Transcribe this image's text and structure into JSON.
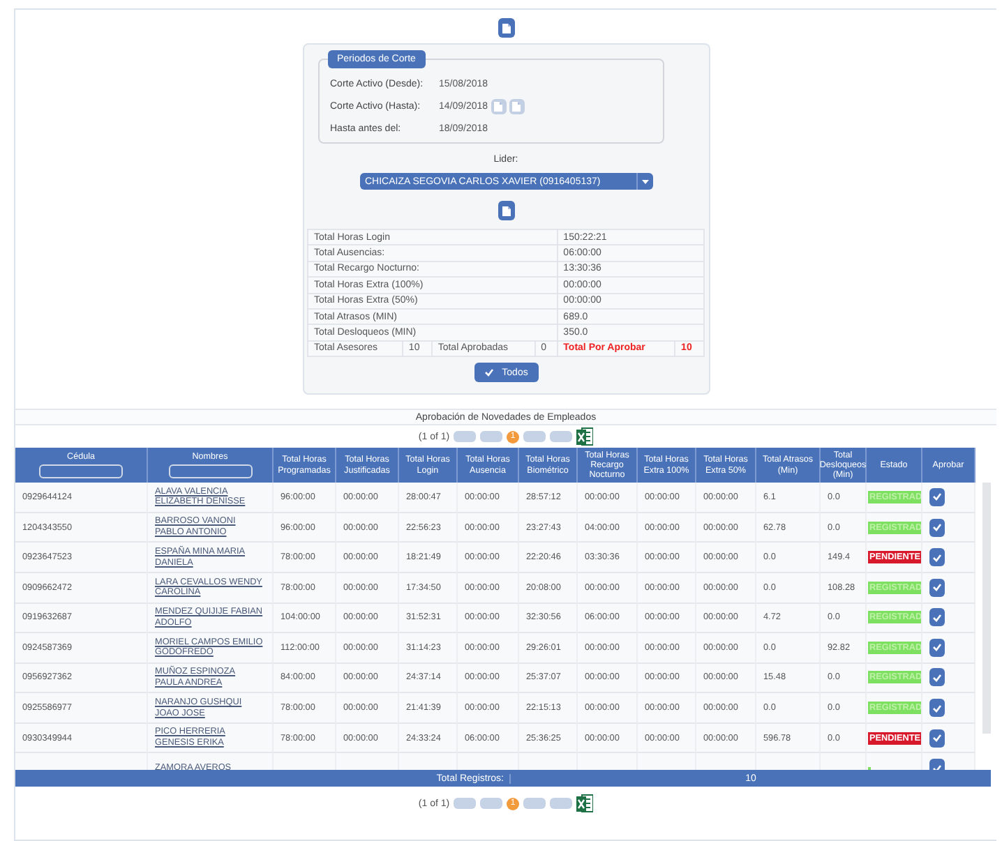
{
  "period_box": {
    "legend": "Periodos de Corte",
    "fields": [
      {
        "label": "Corte Activo (Desde):",
        "value": "15/08/2018",
        "nav": false
      },
      {
        "label": "Corte Activo (Hasta):",
        "value": "14/09/2018",
        "nav": true
      },
      {
        "label": "Hasta antes del:",
        "value": "18/09/2018",
        "nav": false
      }
    ]
  },
  "leader": {
    "label": "Lider:",
    "value": "CHICAIZA SEGOVIA CARLOS XAVIER (0916405137)"
  },
  "summary": [
    {
      "label": "Total Horas Login",
      "value": "150:22:21"
    },
    {
      "label": "Total Ausencias:",
      "value": "06:00:00"
    },
    {
      "label": "Total Recargo Nocturno:",
      "value": "13:30:36"
    },
    {
      "label": "Total Horas Extra (100%)",
      "value": "00:00:00"
    },
    {
      "label": "Total Horas Extra (50%)",
      "value": "00:00:00"
    },
    {
      "label": "Total Atrasos (MIN)",
      "value": "689.0"
    },
    {
      "label": "Total Desloqueos (MIN)",
      "value": "350.0"
    }
  ],
  "counts": [
    {
      "label": "Total Asesores",
      "value": "10",
      "alert": false
    },
    {
      "label": "Total Aprobadas",
      "value": "0",
      "alert": false
    },
    {
      "label": "Total Por Aprobar",
      "value": "10",
      "alert": true
    }
  ],
  "approve_all": "Todos",
  "table": {
    "title": "Aprobación de Novedades de Empleados",
    "paginator": {
      "text": "(1 of 1)",
      "pages": [
        {
          "label": "1",
          "selected": true
        }
      ]
    },
    "columns": [
      {
        "label": "Cédula",
        "filter": true
      },
      {
        "label": "Nombres",
        "filter": true
      },
      {
        "label": "Total Horas Programadas",
        "filter": false
      },
      {
        "label": "Total Horas Justificadas",
        "filter": false
      },
      {
        "label": "Total Horas Login",
        "filter": false
      },
      {
        "label": "Total Horas Ausencia",
        "filter": false
      },
      {
        "label": "Total Horas Biométrico",
        "filter": false
      },
      {
        "label": "Total Horas Recargo Nocturno",
        "filter": false
      },
      {
        "label": "Total Horas Extra 100%",
        "filter": false
      },
      {
        "label": "Total Horas Extra 50%",
        "filter": false
      },
      {
        "label": "Total Atrasos (Min)",
        "filter": false
      },
      {
        "label": "Total Desloqueos (Min)",
        "filter": false
      },
      {
        "label": "Estado",
        "filter": false
      },
      {
        "label": "Aprobar",
        "filter": false
      }
    ],
    "rows": [
      {
        "cedula": "0929644124",
        "name": "ALAVA VALENCIA ELIZABETH DENISSE",
        "values": [
          "96:00:00",
          "00:00:00",
          "28:00:47",
          "00:00:00",
          "28:57:12",
          "00:00:00",
          "00:00:00",
          "00:00:00",
          "6.1",
          "0.0"
        ],
        "status": {
          "text": "REGISTRAD",
          "kind": "registered"
        }
      },
      {
        "cedula": "1204343550",
        "name": "BARROSO VANONI PABLO ANTONIO",
        "values": [
          "96:00:00",
          "00:00:00",
          "22:56:23",
          "00:00:00",
          "23:27:43",
          "04:00:00",
          "00:00:00",
          "00:00:00",
          "62.78",
          "0.0"
        ],
        "status": {
          "text": "REGISTRAD",
          "kind": "registered"
        }
      },
      {
        "cedula": "0923647523",
        "name": "ESPAÑA MINA MARIA DANIELA",
        "values": [
          "78:00:00",
          "00:00:00",
          "18:21:49",
          "00:00:00",
          "22:20:46",
          "03:30:36",
          "00:00:00",
          "00:00:00",
          "0.0",
          "149.4"
        ],
        "status": {
          "text": "PENDIENTE",
          "kind": "pending"
        }
      },
      {
        "cedula": "0909662472",
        "name": "LARA CEVALLOS WENDY CAROLINA",
        "values": [
          "78:00:00",
          "00:00:00",
          "17:34:50",
          "00:00:00",
          "20:08:00",
          "00:00:00",
          "00:00:00",
          "00:00:00",
          "0.0",
          "108.28"
        ],
        "status": {
          "text": "REGISTRAD",
          "kind": "registered"
        }
      },
      {
        "cedula": "0919632687",
        "name": "MENDEZ QUIJIJE FABIAN ADOLFO",
        "values": [
          "104:00:00",
          "00:00:00",
          "31:52:31",
          "00:00:00",
          "32:30:56",
          "06:00:00",
          "00:00:00",
          "00:00:00",
          "4.72",
          "0.0"
        ],
        "status": {
          "text": "REGISTRAD",
          "kind": "registered"
        }
      },
      {
        "cedula": "0924587369",
        "name": "MORIEL CAMPOS EMILIO GODOFREDO",
        "values": [
          "112:00:00",
          "00:00:00",
          "31:14:23",
          "00:00:00",
          "29:26:01",
          "00:00:00",
          "00:00:00",
          "00:00:00",
          "0.0",
          "92.82"
        ],
        "status": {
          "text": "REGISTRAD",
          "kind": "registered"
        }
      },
      {
        "cedula": "0956927362",
        "name": "MUÑOZ ESPINOZA PAULA ANDREA",
        "values": [
          "84:00:00",
          "00:00:00",
          "24:37:14",
          "00:00:00",
          "25:37:07",
          "00:00:00",
          "00:00:00",
          "00:00:00",
          "15.48",
          "0.0"
        ],
        "status": {
          "text": "REGISTRAD",
          "kind": "registered"
        }
      },
      {
        "cedula": "0925586977",
        "name": "NARANJO GUSHQUI JOAO JOSE",
        "values": [
          "78:00:00",
          "00:00:00",
          "21:41:39",
          "00:00:00",
          "22:15:13",
          "00:00:00",
          "00:00:00",
          "00:00:00",
          "0.0",
          "0.0"
        ],
        "status": {
          "text": "REGISTRAD",
          "kind": "registered"
        }
      },
      {
        "cedula": "0930349944",
        "name": "PICO HERRERIA GENESIS ERIKA",
        "values": [
          "78:00:00",
          "00:00:00",
          "24:33:24",
          "06:00:00",
          "25:36:25",
          "00:00:00",
          "00:00:00",
          "00:00:00",
          "596.78",
          "0.0"
        ],
        "status": {
          "text": "PENDIENTE",
          "kind": "pending"
        }
      },
      {
        "name": "ZAMORA AVEROS",
        "status": {
          "kind": "registered"
        }
      }
    ],
    "footer": {
      "label": "Total Registros:",
      "value": "10"
    },
    "paginator_bottom": {
      "text": "(1 of 1)",
      "pages": [
        {
          "label": "1",
          "selected": true
        }
      ]
    }
  }
}
